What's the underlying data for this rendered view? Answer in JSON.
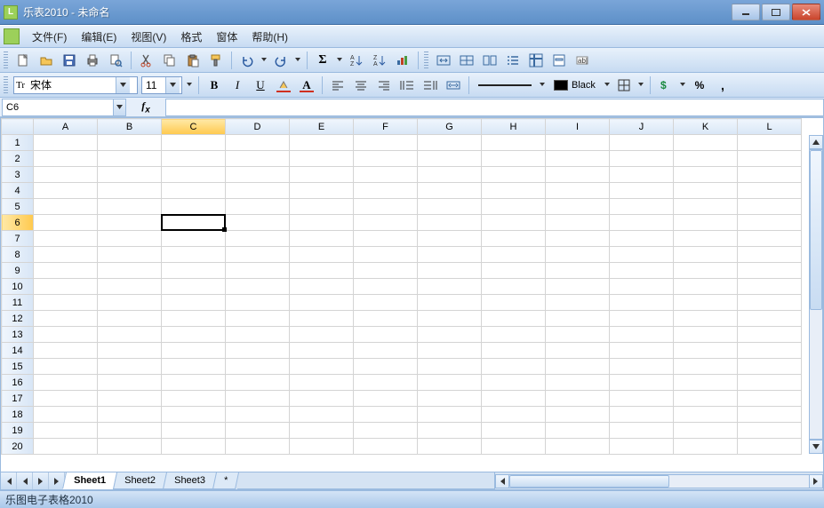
{
  "window": {
    "title": "乐表2010 - 未命名"
  },
  "menu": {
    "items": [
      "文件(F)",
      "编辑(E)",
      "视图(V)",
      "格式",
      "窗体",
      "帮助(H)"
    ]
  },
  "toolbar1": {
    "buttons": [
      "new",
      "open",
      "save",
      "print",
      "print-preview",
      "",
      "cut",
      "copy",
      "paste",
      "format-painter",
      "",
      "undo",
      "redo",
      "",
      "sum",
      "sort-asc",
      "sort-desc",
      "chart"
    ],
    "group2": [
      "merge-cells",
      "insert-table",
      "border-bottom",
      "align-distribute",
      "freeze-panes",
      "form",
      "abc-spellcheck"
    ]
  },
  "format": {
    "font_name": "宋体",
    "font_size": "11",
    "color_name": "Black"
  },
  "namebox": {
    "value": "C6"
  },
  "formula": {
    "value": ""
  },
  "grid": {
    "columns": [
      "A",
      "B",
      "C",
      "D",
      "E",
      "F",
      "G",
      "H",
      "I",
      "J",
      "K",
      "L"
    ],
    "rows": [
      1,
      2,
      3,
      4,
      5,
      6,
      7,
      8,
      9,
      10,
      11,
      12,
      13,
      14,
      15,
      16,
      17,
      18,
      19,
      20
    ],
    "active": {
      "col": 2,
      "row": 5
    }
  },
  "tabs": {
    "items": [
      "Sheet1",
      "Sheet2",
      "Sheet3"
    ],
    "active": 0
  },
  "status": {
    "text": "乐图电子表格2010"
  }
}
